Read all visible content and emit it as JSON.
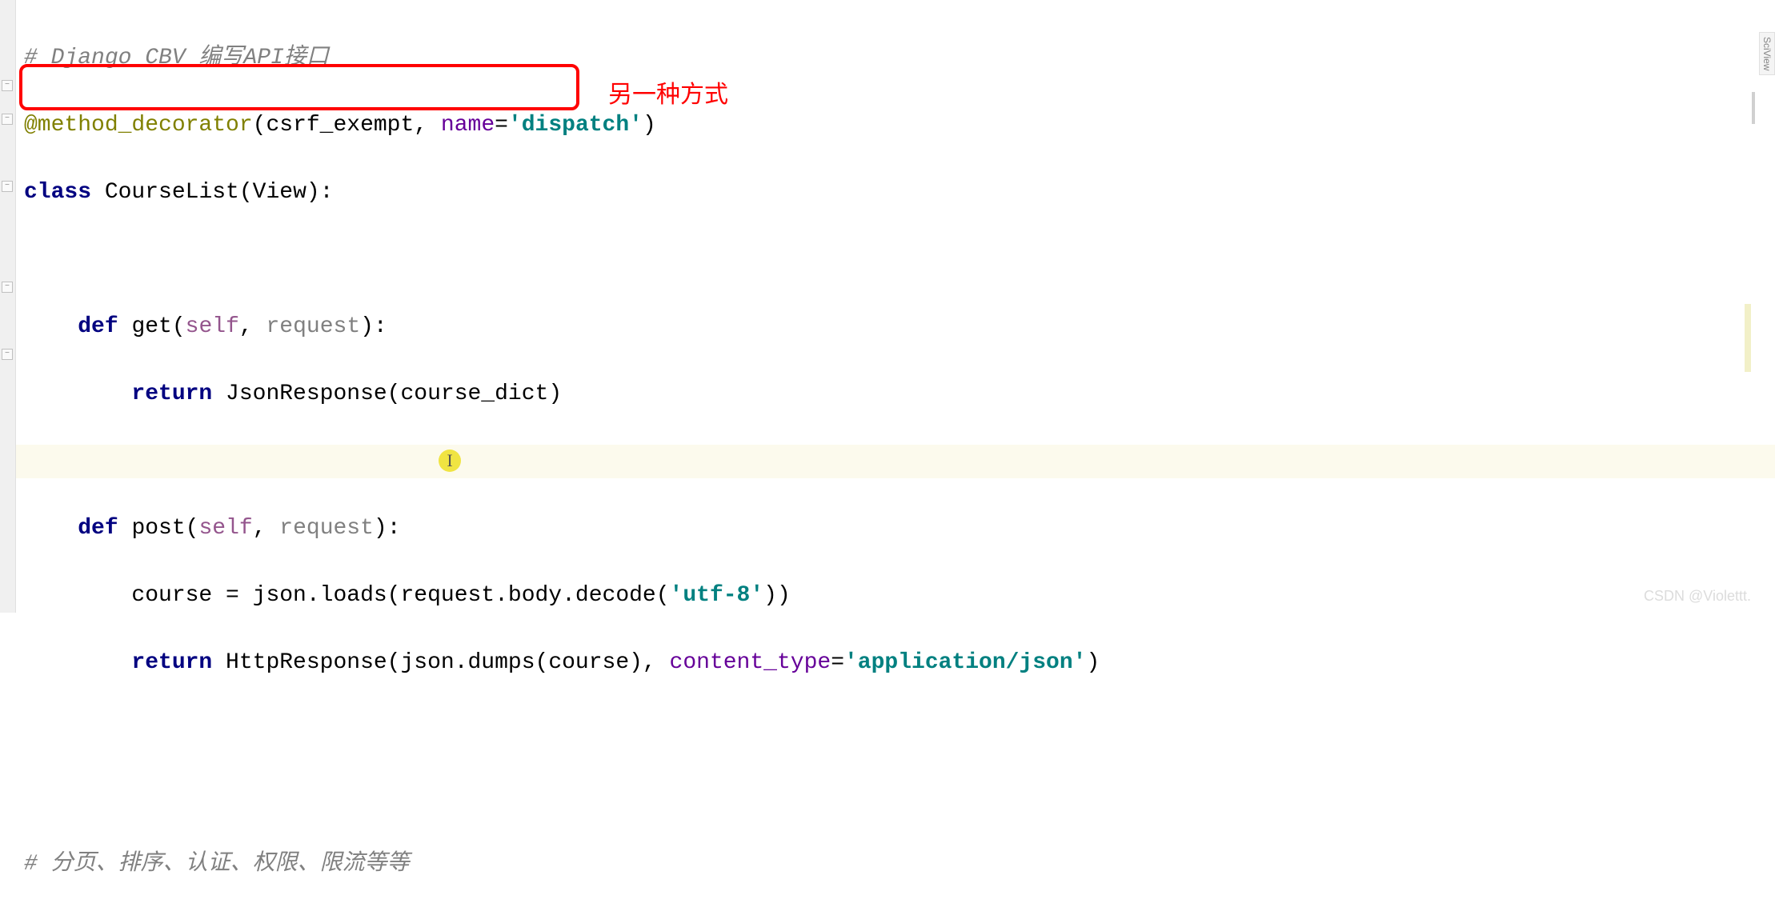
{
  "code": {
    "comment1": "# Django CBV 编写API接口",
    "decorator_at": "@method_decorator",
    "decorator_open": "(csrf_exempt, ",
    "decorator_name_kw": "name",
    "decorator_eq": "=",
    "decorator_str": "'dispatch'",
    "decorator_close": ")",
    "class_kw": "class ",
    "class_name": "CourseList(View):",
    "def_kw": "def ",
    "get_name": "get",
    "get_params_open": "(",
    "self_kw": "self",
    "comma_sp": ", ",
    "request_param": "request",
    "params_close": "):",
    "return_kw": "return ",
    "json_response": "JsonResponse(course_dict)",
    "post_name": "post",
    "course_assign": "course = json.loads(request.body.decode(",
    "utf8_str": "'utf-8'",
    "close_paren2": "))",
    "http_response": "HttpResponse(json.dumps(course), ",
    "content_type_kw": "content_type",
    "eq": "=",
    "app_json_str": "'application/json'",
    "close_paren1": ")",
    "comment2": "# 分页、排序、认证、权限、限流等等"
  },
  "annotation": "另一种方式",
  "watermark": "CSDN @Violettt.",
  "side_tab": "SciView",
  "caret_glyph": "I"
}
